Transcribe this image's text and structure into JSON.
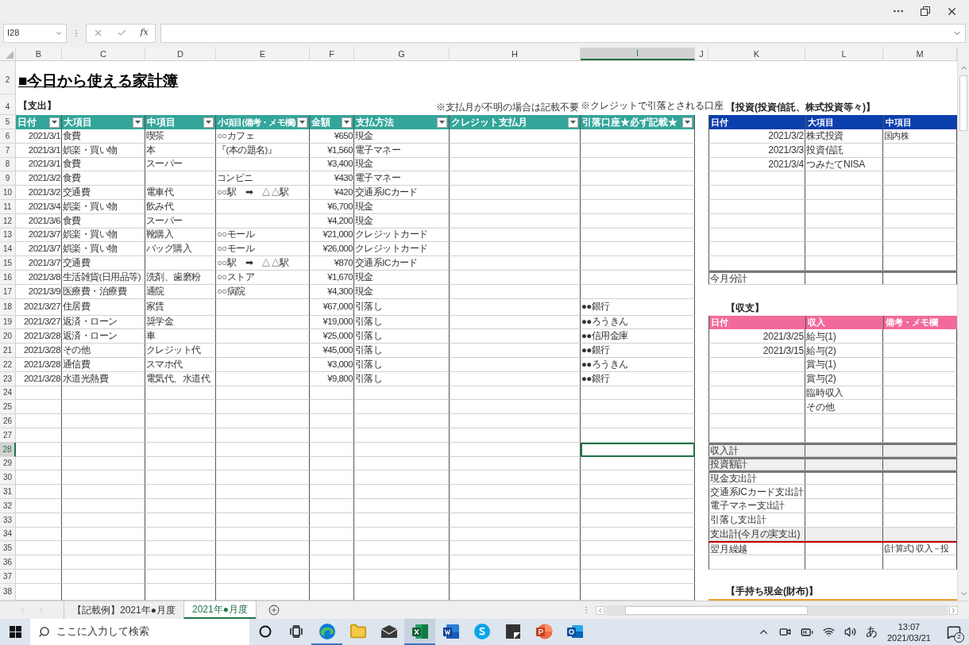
{
  "formula_bar": {
    "name_box": "I28",
    "function_label": "fx"
  },
  "columns": [
    {
      "label": "B",
      "selected": false
    },
    {
      "label": "C",
      "selected": false
    },
    {
      "label": "D",
      "selected": false
    },
    {
      "label": "E",
      "selected": false
    },
    {
      "label": "F",
      "selected": false
    },
    {
      "label": "G",
      "selected": false
    },
    {
      "label": "H",
      "selected": false
    },
    {
      "label": "I",
      "selected": true
    },
    {
      "label": "J",
      "selected": false
    },
    {
      "label": "K",
      "selected": false
    },
    {
      "label": "L",
      "selected": false
    },
    {
      "label": "M",
      "selected": false
    }
  ],
  "rows": [
    {
      "selected": false,
      "left": {
        "kind": "gap"
      },
      "right": {
        "kind": "none"
      }
    },
    {
      "number": "2",
      "selected": false,
      "left": {
        "kind": "title",
        "B": "■今日から使える家計簿"
      },
      "right": {
        "kind": "none"
      }
    },
    {
      "selected": false,
      "left": {
        "kind": "gap"
      },
      "right": {
        "kind": "none"
      }
    },
    {
      "number": "4",
      "selected": false,
      "left": {
        "kind": "labels",
        "B": "【支出】",
        "H": "※支払月が不明の場合は記載不要",
        "I": "※クレジットで引落とされる口座"
      },
      "right": {
        "kind": "heading",
        "K": "【投資(投資信託、株式投資等々)】"
      }
    },
    {
      "number": "5",
      "selected": false,
      "left": {
        "kind": "header",
        "B": "日付",
        "C": "大項目",
        "D": "中項目",
        "E": "小項目(備考・メモ欄)",
        "F": "金額",
        "G": "支払方法",
        "H": "クレジット支払月",
        "I": "引落口座★必ず記載★"
      },
      "right": {
        "kind": "header_invest",
        "K": "日付",
        "L": "大項目",
        "M": "中項目"
      }
    },
    {
      "number": "6",
      "selected": false,
      "left": {
        "kind": "data",
        "B": "2021/3/1",
        "C": "食費",
        "D": "喫茶",
        "E": "○○カフェ",
        "F": "¥650",
        "G": "現金"
      },
      "right": {
        "kind": "data",
        "K": "2021/3/2",
        "L": "株式投資",
        "M": "国内株"
      }
    },
    {
      "number": "7",
      "selected": false,
      "left": {
        "kind": "data",
        "B": "2021/3/1",
        "C": "娯楽・買い物",
        "D": "本",
        "E": "『(本の題名)』",
        "F": "¥1,560",
        "G": "電子マネー"
      },
      "right": {
        "kind": "data",
        "K": "2021/3/3",
        "L": "投資信託"
      }
    },
    {
      "number": "8",
      "selected": false,
      "left": {
        "kind": "data",
        "B": "2021/3/1",
        "C": "食費",
        "D": "スーパー",
        "F": "¥3,400",
        "G": "現金"
      },
      "right": {
        "kind": "data",
        "K": "2021/3/4",
        "L": "つみたてNISA"
      }
    },
    {
      "number": "9",
      "selected": false,
      "left": {
        "kind": "data",
        "B": "2021/3/2",
        "C": "食費",
        "E": "コンビニ",
        "F": "¥430",
        "G": "電子マネー"
      },
      "right": {
        "kind": "data"
      }
    },
    {
      "number": "10",
      "selected": false,
      "left": {
        "kind": "data",
        "B": "2021/3/2",
        "C": "交通費",
        "D": "電車代",
        "E": "○○駅　➡　△△駅",
        "F": "¥420",
        "G": "交通系ICカード"
      },
      "right": {
        "kind": "data"
      }
    },
    {
      "number": "11",
      "selected": false,
      "left": {
        "kind": "data",
        "B": "2021/3/4",
        "C": "娯楽・買い物",
        "D": "飲み代",
        "F": "¥6,700",
        "G": "現金"
      },
      "right": {
        "kind": "data"
      }
    },
    {
      "number": "12",
      "selected": false,
      "left": {
        "kind": "data",
        "B": "2021/3/6",
        "C": "食費",
        "D": "スーパー",
        "F": "¥4,200",
        "G": "現金"
      },
      "right": {
        "kind": "data"
      }
    },
    {
      "number": "13",
      "selected": false,
      "left": {
        "kind": "data",
        "B": "2021/3/7",
        "C": "娯楽・買い物",
        "D": "靴購入",
        "E": "○○モール",
        "F": "¥21,000",
        "G": "クレジットカード"
      },
      "right": {
        "kind": "data"
      }
    },
    {
      "number": "14",
      "selected": false,
      "left": {
        "kind": "data",
        "B": "2021/3/7",
        "C": "娯楽・買い物",
        "D": "バッグ購入",
        "E": "○○モール",
        "F": "¥26,000",
        "G": "クレジットカード"
      },
      "right": {
        "kind": "data"
      }
    },
    {
      "number": "15",
      "selected": false,
      "left": {
        "kind": "data",
        "B": "2021/3/7",
        "C": "交通費",
        "E": "○○駅　➡　△△駅",
        "F": "¥870",
        "G": "交通系ICカード"
      },
      "right": {
        "kind": "data"
      }
    },
    {
      "number": "16",
      "selected": false,
      "left": {
        "kind": "data",
        "B": "2021/3/8",
        "C": "生活雑貨(日用品等)",
        "D": "洗剤、歯磨粉",
        "E": "○○ストア",
        "F": "¥1,670",
        "G": "現金"
      },
      "right": {
        "kind": "total_thick",
        "K": "今月分計"
      }
    },
    {
      "number": "17",
      "selected": false,
      "left": {
        "kind": "data",
        "B": "2021/3/9",
        "C": "医療費・治療費",
        "D": "通院",
        "E": "○○病院",
        "F": "¥4,300",
        "G": "現金"
      },
      "right": {
        "kind": "none"
      }
    },
    {
      "number": "18",
      "selected": false,
      "left": {
        "kind": "data",
        "B": "2021/3/27",
        "C": "住居費",
        "D": "家賃",
        "F": "¥67,000",
        "G": "引落し",
        "I": "●●銀行"
      },
      "right": {
        "kind": "heading",
        "K": "【収支】"
      }
    },
    {
      "number": "19",
      "selected": false,
      "left": {
        "kind": "data",
        "B": "2021/3/27",
        "C": "返済・ローン",
        "D": "奨学金",
        "F": "¥19,000",
        "G": "引落し",
        "I": "●●ろうきん"
      },
      "right": {
        "kind": "header_income",
        "K": "日付",
        "L": "収入",
        "M": "備考・メモ欄"
      }
    },
    {
      "number": "20",
      "selected": false,
      "left": {
        "kind": "data",
        "B": "2021/3/28",
        "C": "返済・ローン",
        "D": "車",
        "F": "¥25,000",
        "G": "引落し",
        "I": "●●信用金庫"
      },
      "right": {
        "kind": "data",
        "K": "2021/3/25",
        "L": "給与(1)"
      }
    },
    {
      "number": "21",
      "selected": false,
      "left": {
        "kind": "data",
        "B": "2021/3/28",
        "C": "その他",
        "D": "クレジット代",
        "F": "¥45,000",
        "G": "引落し",
        "I": "●●銀行"
      },
      "right": {
        "kind": "data",
        "K": "2021/3/15",
        "L": "給与(2)"
      }
    },
    {
      "number": "22",
      "selected": false,
      "left": {
        "kind": "data",
        "B": "2021/3/28",
        "C": "通信費",
        "D": "スマホ代",
        "F": "¥3,000",
        "G": "引落し",
        "I": "●●ろうきん"
      },
      "right": {
        "kind": "data",
        "L": "賞与(1)"
      }
    },
    {
      "number": "23",
      "selected": false,
      "left": {
        "kind": "data",
        "B": "2021/3/28",
        "C": "水道光熱費",
        "D": "電気代、水道代",
        "F": "¥9,800",
        "G": "引落し",
        "I": "●●銀行"
      },
      "right": {
        "kind": "data",
        "L": "賞与(2)"
      }
    },
    {
      "number": "24",
      "selected": false,
      "left": {
        "kind": "data"
      },
      "right": {
        "kind": "data",
        "L": "臨時収入"
      }
    },
    {
      "number": "25",
      "selected": false,
      "left": {
        "kind": "data"
      },
      "right": {
        "kind": "data",
        "L": "その他"
      }
    },
    {
      "number": "26",
      "selected": false,
      "left": {
        "kind": "data"
      },
      "right": {
        "kind": "data"
      }
    },
    {
      "number": "27",
      "selected": false,
      "left": {
        "kind": "data"
      },
      "right": {
        "kind": "data"
      }
    },
    {
      "number": "28",
      "selected": true,
      "left": {
        "kind": "data"
      },
      "right": {
        "kind": "shaded_thick",
        "K": "収入計"
      }
    },
    {
      "number": "29",
      "selected": false,
      "left": {
        "kind": "data"
      },
      "right": {
        "kind": "shaded_thick",
        "K": "投資額計"
      }
    },
    {
      "number": "30",
      "selected": false,
      "left": {
        "kind": "data"
      },
      "right": {
        "kind": "total_thick",
        "K": "現金支出計"
      }
    },
    {
      "number": "31",
      "selected": false,
      "left": {
        "kind": "data"
      },
      "right": {
        "kind": "total",
        "K": "交通系ICカード支出計"
      }
    },
    {
      "number": "32",
      "selected": false,
      "left": {
        "kind": "data"
      },
      "right": {
        "kind": "total",
        "K": "電子マネー支出計"
      }
    },
    {
      "number": "33",
      "selected": false,
      "left": {
        "kind": "data"
      },
      "right": {
        "kind": "total",
        "K": "引落し支出計"
      }
    },
    {
      "number": "34",
      "selected": false,
      "left": {
        "kind": "data"
      },
      "right": {
        "kind": "shaded",
        "K": "支出計(今月の実支出)"
      }
    },
    {
      "number": "35",
      "selected": false,
      "left": {
        "kind": "data"
      },
      "right": {
        "kind": "total_red",
        "K": "翌月繰越",
        "M": "(計算式) 収入－投"
      }
    },
    {
      "number": "36",
      "selected": false,
      "left": {
        "kind": "data"
      },
      "right": {
        "kind": "total"
      }
    },
    {
      "number": "37",
      "selected": false,
      "left": {
        "kind": "data"
      },
      "right": {
        "kind": "none"
      }
    },
    {
      "number": "38",
      "selected": false,
      "left": {
        "kind": "data"
      },
      "right": {
        "kind": "heading_bar",
        "K": "【手持ち現金(財布)】"
      }
    }
  ],
  "sheet_tabs": [
    {
      "label": "【記載例】2021年●月度",
      "selected": false
    },
    {
      "label": "2021年●月度",
      "selected": true
    }
  ],
  "taskbar": {
    "search_placeholder": "ここに入力して検索",
    "apps": [
      {
        "kind": "cortana",
        "open": false,
        "selected": false
      },
      {
        "kind": "taskview",
        "open": false,
        "selected": false
      },
      {
        "kind": "edge",
        "open": true,
        "selected": false
      },
      {
        "kind": "explorer",
        "open": false,
        "selected": false
      },
      {
        "kind": "mail",
        "open": false,
        "selected": false
      },
      {
        "kind": "excel",
        "open": true,
        "selected": true
      },
      {
        "kind": "word",
        "open": false,
        "selected": false
      },
      {
        "kind": "skype",
        "open": false,
        "selected": false
      },
      {
        "kind": "note",
        "open": false,
        "selected": false
      },
      {
        "kind": "powerpoint",
        "open": false,
        "selected": false
      },
      {
        "kind": "outlook",
        "open": false,
        "selected": false
      }
    ],
    "ime": "あ",
    "time": "13:07",
    "date": "2021/03/21",
    "notification_count": "2"
  }
}
